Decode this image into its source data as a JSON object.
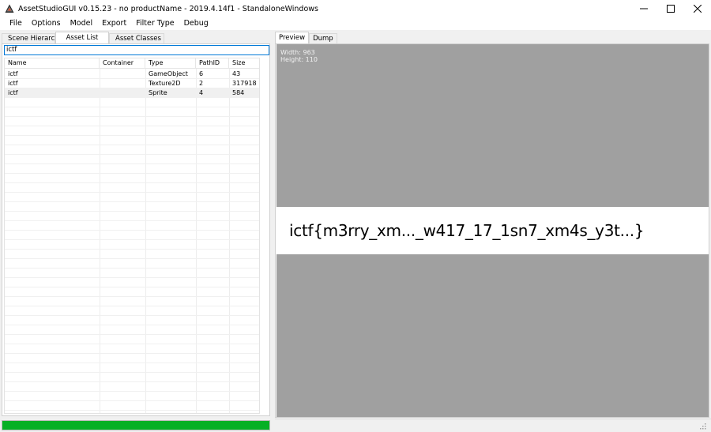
{
  "window": {
    "title": "AssetStudioGUI v0.15.23 - no productName - 2019.4.14f1 - StandaloneWindows",
    "controls": [
      "minimize-icon",
      "maximize-icon",
      "close-icon"
    ]
  },
  "menu": {
    "items": [
      "File",
      "Options",
      "Model",
      "Export",
      "Filter Type",
      "Debug"
    ]
  },
  "left_tabs": {
    "scene_hierarchy": "Scene Hierarchy",
    "asset_list": "Asset List",
    "asset_classes": "Asset Classes"
  },
  "search": {
    "value": "ictf"
  },
  "asset_table": {
    "columns": [
      "Name",
      "Container",
      "Type",
      "PathID",
      "Size"
    ],
    "rows": [
      {
        "name": "ictf",
        "container": "",
        "type": "GameObject",
        "path_id": "6",
        "size": "43"
      },
      {
        "name": "ictf",
        "container": "",
        "type": "Texture2D",
        "path_id": "2",
        "size": "317918"
      },
      {
        "name": "ictf",
        "container": "",
        "type": "Sprite",
        "path_id": "4",
        "size": "584"
      }
    ],
    "selected_row": 2
  },
  "progress": {
    "value": 1.0,
    "color": "#06b025"
  },
  "right_tabs": {
    "preview": "Preview",
    "dump": "Dump"
  },
  "preview": {
    "width_label": "Width: 963",
    "height_label": "Height: 110",
    "image_text": "ictf{m3rry_xm..._w417_17_1sn7_xm4s_y3t...}",
    "background_color": "#a0a0a0"
  }
}
